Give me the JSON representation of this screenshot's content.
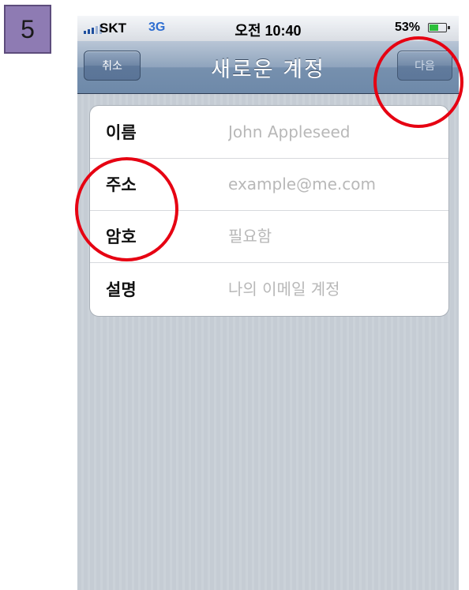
{
  "step": {
    "number": "5"
  },
  "statusbar": {
    "carrier": "SKT",
    "network": "3G",
    "time": "오전 10:40",
    "battery": "53%"
  },
  "navbar": {
    "title": "새로운 계정",
    "cancel_label": "취소",
    "next_label": "다음"
  },
  "form": {
    "rows": [
      {
        "label": "이름",
        "placeholder": "John Appleseed"
      },
      {
        "label": "주소",
        "placeholder": "example@me.com"
      },
      {
        "label": "암호",
        "placeholder": "필요함"
      },
      {
        "label": "설명",
        "placeholder": "나의 이메일 계정"
      }
    ]
  },
  "annotations": {
    "highlight_color": "#e60012"
  },
  "icons": [
    "signal-icon",
    "battery-icon"
  ]
}
